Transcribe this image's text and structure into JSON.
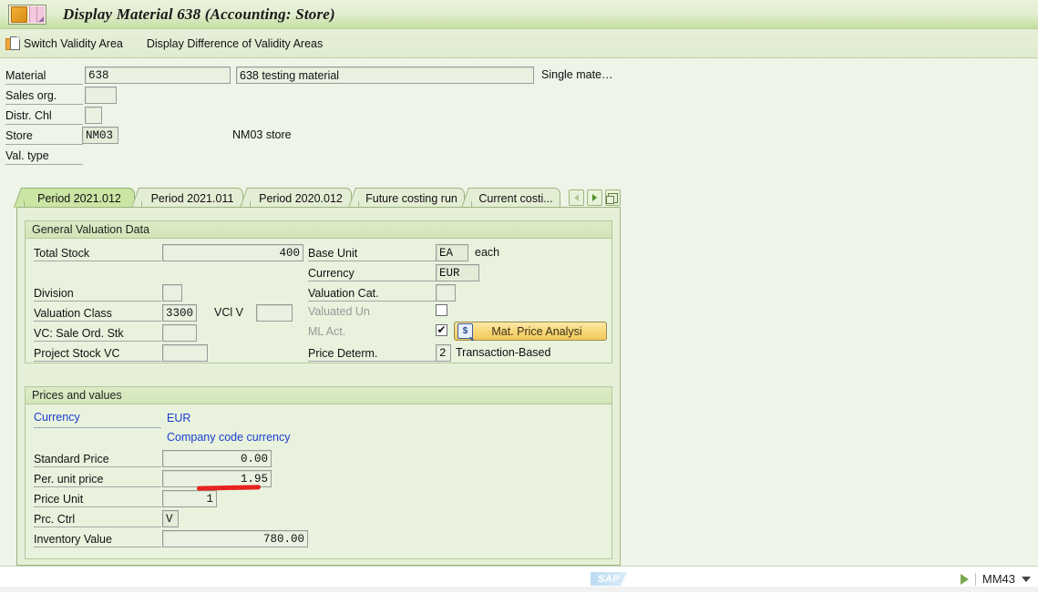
{
  "window": {
    "title": "Display Material 638 (Accounting: Store)",
    "app_icon": "material-display-icon"
  },
  "toolbar": {
    "switch_validity_area": "Switch Validity Area",
    "switch_validity_icon": "copy-document-icon",
    "display_difference": "Display Difference of Validity Areas"
  },
  "header_form": {
    "material_label": "Material",
    "material_value": "638",
    "material_desc": "638 testing material",
    "single_material": "Single mate…",
    "sales_org_label": "Sales org.",
    "sales_org_value": "",
    "distr_chl_label": "Distr. Chl",
    "distr_chl_value": "",
    "store_label": "Store",
    "store_value": "NM03",
    "store_desc": "NM03 store",
    "val_type_label": "Val. type"
  },
  "tabs": {
    "items": [
      {
        "label": "Period 2021.012",
        "selected": true
      },
      {
        "label": "Period 2021.011",
        "selected": false
      },
      {
        "label": "Period 2020.012",
        "selected": false
      },
      {
        "label": "Future costing run",
        "selected": false
      },
      {
        "label": "Current costi...",
        "selected": false
      }
    ],
    "nav_prev_icon": "triangle-left-icon",
    "nav_next_icon": "triangle-right-icon",
    "nav_list_icon": "tab-overview-icon"
  },
  "general_valuation": {
    "title": "General Valuation Data",
    "total_stock_label": "Total Stock",
    "total_stock_value": "400",
    "base_unit_label": "Base Unit",
    "base_unit_value": "EA",
    "base_unit_text": "each",
    "currency_label": "Currency",
    "currency_value": "EUR",
    "division_label": "Division",
    "division_value": "",
    "valuation_cat_label": "Valuation Cat.",
    "valuation_cat_value": "",
    "valuation_class_label": "Valuation Class",
    "valuation_class_value": "3300",
    "vcl_v_label": "VCl V",
    "vcl_v_value": "",
    "valuated_un_label": "Valuated Un",
    "valuated_un_checked": false,
    "vc_sale_ord_label": "VC: Sale Ord. Stk",
    "vc_sale_ord_value": "",
    "ml_act_label": "ML Act.",
    "ml_act_checked": true,
    "ml_act_mark": "✔",
    "mat_price_analysis_label": "Mat. Price Analysi",
    "mat_price_analysis_icon": "magnifier-dollar-icon",
    "project_stock_label": "Project Stock VC",
    "project_stock_value": "",
    "price_determ_label": "Price Determ.",
    "price_determ_value": "2",
    "price_determ_text": "Transaction-Based"
  },
  "prices_values": {
    "title": "Prices and values",
    "currency_label": "Currency",
    "currency_value": "EUR",
    "company_code_currency": "Company code currency",
    "standard_price_label": "Standard Price",
    "standard_price_value": "0.00",
    "per_unit_price_label": "Per. unit price",
    "per_unit_price_value": "1.95",
    "price_unit_label": "Price Unit",
    "price_unit_value": "1",
    "prc_ctrl_label": "Prc. Ctrl",
    "prc_ctrl_value": "V",
    "inventory_value_label": "Inventory Value",
    "inventory_value_value": "780.00"
  },
  "annotation": {
    "color": "#e8221f",
    "target": "per_unit_price_value"
  },
  "status_bar": {
    "logo": "SAP",
    "play_icon": "triangle-right-icon",
    "transaction": "MM43",
    "caret_icon": "caret-down-icon"
  }
}
